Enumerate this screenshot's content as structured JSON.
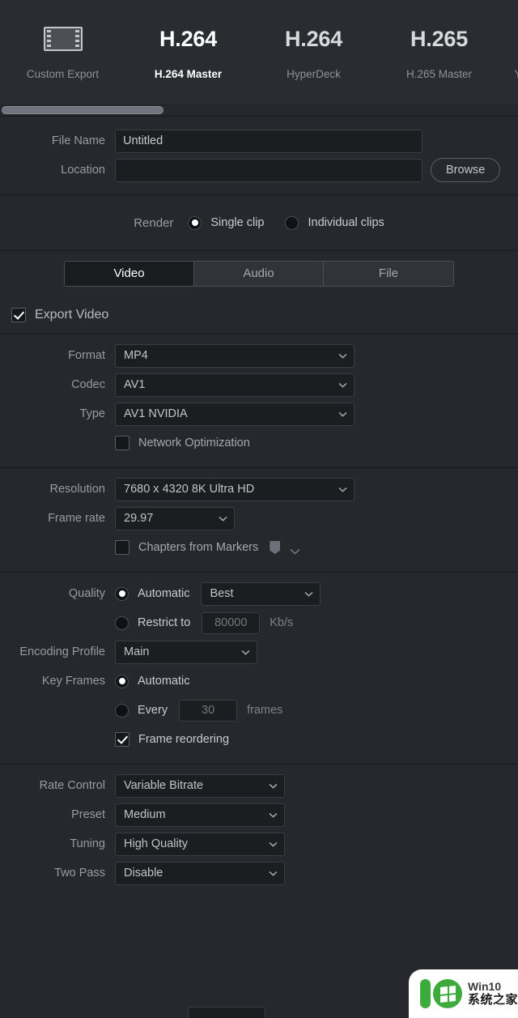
{
  "presets": [
    {
      "label": "Custom Export",
      "icon": "film-strip-icon",
      "codec": "",
      "active": false
    },
    {
      "label": "H.264 Master",
      "icon": "codec-text",
      "codec": "H.264",
      "active": true
    },
    {
      "label": "HyperDeck",
      "icon": "codec-text",
      "codec": "H.264",
      "active": false
    },
    {
      "label": "H.265 Master",
      "icon": "codec-text",
      "codec": "H.265",
      "active": false
    },
    {
      "label": "Y",
      "icon": "codec-text",
      "codec": "",
      "active": false
    }
  ],
  "file": {
    "name_label": "File Name",
    "name_value": "Untitled",
    "location_label": "Location",
    "location_value": "",
    "browse_label": "Browse"
  },
  "render": {
    "label": "Render",
    "single_clip_label": "Single clip",
    "individual_clips_label": "Individual clips",
    "selected": "single_clip"
  },
  "tabs": [
    {
      "label": "Video",
      "active": true
    },
    {
      "label": "Audio",
      "active": false
    },
    {
      "label": "File",
      "active": false
    }
  ],
  "export_video": {
    "label": "Export Video",
    "checked": true
  },
  "video": {
    "format_label": "Format",
    "format_value": "MP4",
    "codec_label": "Codec",
    "codec_value": "AV1",
    "type_label": "Type",
    "type_value": "AV1 NVIDIA",
    "network_optimization_label": "Network Optimization",
    "network_optimization_checked": false,
    "resolution_label": "Resolution",
    "resolution_value": "7680 x 4320 8K Ultra HD",
    "frame_rate_label": "Frame rate",
    "frame_rate_value": "29.97",
    "chapters_label": "Chapters from Markers",
    "chapters_checked": false
  },
  "quality": {
    "label": "Quality",
    "automatic_label": "Automatic",
    "automatic_value": "Best",
    "restrict_label": "Restrict to",
    "restrict_value": "80000",
    "restrict_unit": "Kb/s",
    "selected": "automatic"
  },
  "encoding_profile": {
    "label": "Encoding Profile",
    "value": "Main"
  },
  "key_frames": {
    "label": "Key Frames",
    "automatic_label": "Automatic",
    "every_label": "Every",
    "every_value": "30",
    "every_unit": "frames",
    "selected": "automatic",
    "frame_reordering_label": "Frame reordering",
    "frame_reordering_checked": true
  },
  "advanced": {
    "rate_control_label": "Rate Control",
    "rate_control_value": "Variable Bitrate",
    "preset_label": "Preset",
    "preset_value": "Medium",
    "tuning_label": "Tuning",
    "tuning_value": "High Quality",
    "two_pass_label": "Two Pass",
    "two_pass_value": "Disable"
  },
  "watermark": {
    "line1": "Win10",
    "line2": "系统之家"
  },
  "colors": {
    "panel_bg": "#26282e",
    "strip_bg": "#2a2c32",
    "input_bg": "#1c1d21",
    "divider": "#17181c",
    "text": "#b4b7bd",
    "text_dim": "#8e9196",
    "accent_white": "#ffffff",
    "watermark_green": "#3cab3c"
  }
}
